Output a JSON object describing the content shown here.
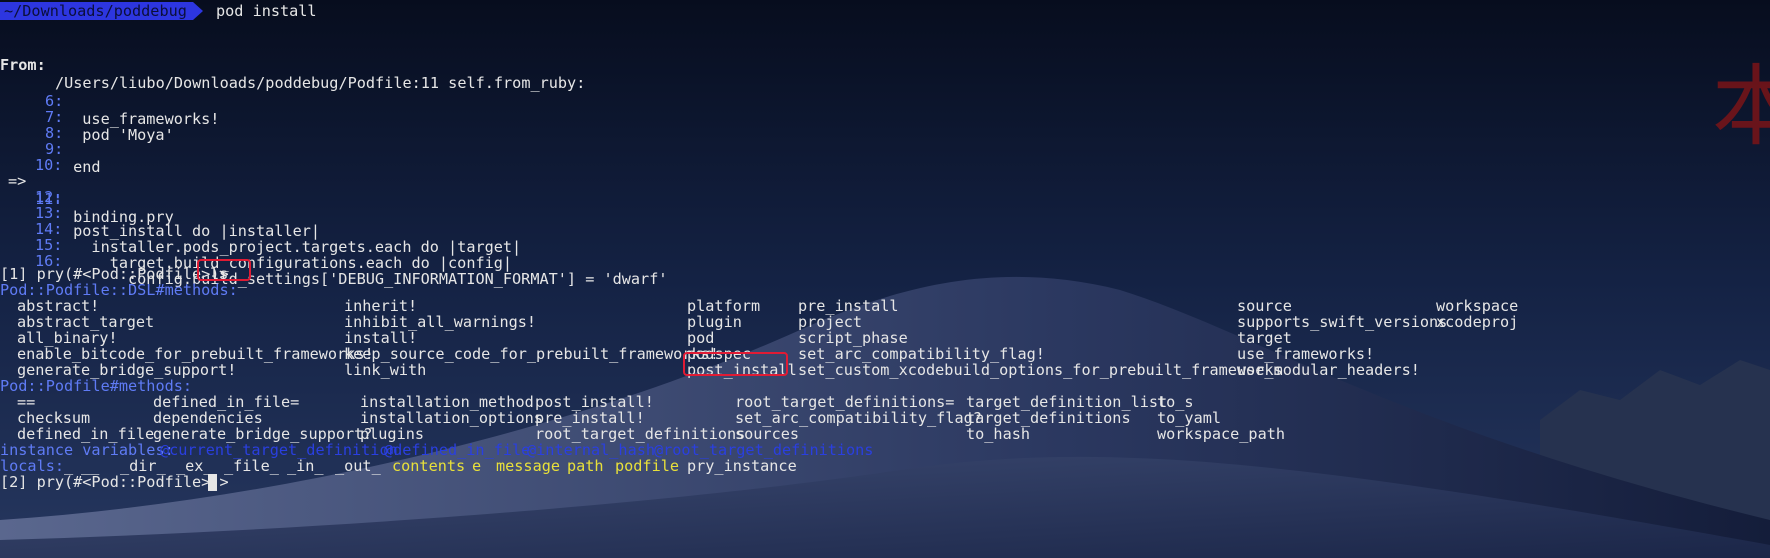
{
  "window": {
    "prompt_path": "~/Downloads/poddebug",
    "command": "pod install"
  },
  "from_line": {
    "label": "From:",
    "path": "/Users/liubo/Downloads/poddebug/Podfile:11 self.from_ruby:"
  },
  "source_lines": [
    {
      "marker": "",
      "num": "6:",
      "code": "  use_frameworks!"
    },
    {
      "marker": "",
      "num": "7:",
      "code": "  pod 'Moya'"
    },
    {
      "marker": "",
      "num": "8:",
      "code": ""
    },
    {
      "marker": "",
      "num": "9:",
      "code": " end"
    },
    {
      "marker": "",
      "num": "10:",
      "code": ""
    },
    {
      "marker": "=>",
      "num": "11:",
      "code": " binding.pry"
    },
    {
      "marker": "",
      "num": "12:",
      "code": ""
    },
    {
      "marker": "",
      "num": "13:",
      "code": " post_install do |installer|"
    },
    {
      "marker": "",
      "num": "14:",
      "code": "   installer.pods_project.targets.each do |target|"
    },
    {
      "marker": "",
      "num": "15:",
      "code": "     target.build_configurations.each do |config|"
    },
    {
      "marker": "",
      "num": "16:",
      "code": "       config.build_settings['DEBUG_INFORMATION_FORMAT'] = 'dwarf'"
    }
  ],
  "prompt1": {
    "prefix": "[1] pry(#<Pod::Podfile>)>",
    "input": "ls"
  },
  "dsl_methods": {
    "header": "Pod::Podfile::DSL#methods:",
    "col1": [
      "abstract!",
      "abstract_target",
      "all_binary!",
      "enable_bitcode_for_prebuilt_frameworks!",
      "generate_bridge_support!"
    ],
    "col2": [
      "inherit!",
      "inhibit_all_warnings!",
      "install!",
      "keep_source_code_for_prebuilt_frameworks!",
      "link_with"
    ],
    "col3": [
      "platform",
      "plugin",
      "pod",
      "podspec",
      "post_install"
    ],
    "col4": [
      "pre_install",
      "project",
      "script_phase",
      "set_arc_compatibility_flag!",
      "set_custom_xcodebuild_options_for_prebuilt_frameworks"
    ],
    "col5": [
      "source",
      "supports_swift_versions",
      "target",
      "use_frameworks!",
      "use_modular_headers!"
    ],
    "col6": [
      "workspace",
      "xcodeproj"
    ]
  },
  "podfile_methods": {
    "header": "Pod::Podfile#methods:",
    "col1": [
      "==",
      "checksum",
      "defined_in_file"
    ],
    "col2": [
      "defined_in_file=",
      "dependencies",
      "generate_bridge_support?"
    ],
    "col3": [
      "installation_method",
      "installation_options",
      "plugins"
    ],
    "col4": [
      "post_install!",
      "pre_install!",
      "root_target_definitions"
    ],
    "col5": [
      "root_target_definitions=",
      "set_arc_compatibility_flag?",
      "sources"
    ],
    "col6": [
      "target_definition_list",
      "target_definitions",
      "to_hash"
    ],
    "col7": [
      "to_s",
      "to_yaml",
      "workspace_path"
    ]
  },
  "instance_variables": {
    "label": "instance variables:",
    "items": [
      "@current_target_definition",
      "@defined_in_file",
      "@internal_hash",
      "@root_target_definitions"
    ]
  },
  "locals": {
    "label": "locals:",
    "plain": [
      "_",
      "__",
      "_dir_",
      "_ex_",
      "_file_",
      "_in_",
      "_out_"
    ],
    "highlighted": [
      "contents",
      "e",
      "message",
      "path",
      "podfile",
      "pry_instance"
    ]
  },
  "prompt2": {
    "prefix": "[2] pry(#<Pod::Podfile>)>"
  },
  "side_glyph": "本",
  "colors": {
    "prompt_bg": "#2d36e0",
    "line_numbers": "#5f7bf5",
    "instance_vars": "#2a3fe0",
    "locals_highlight": "#e8e03a",
    "highlight_box": "#e01b34"
  }
}
